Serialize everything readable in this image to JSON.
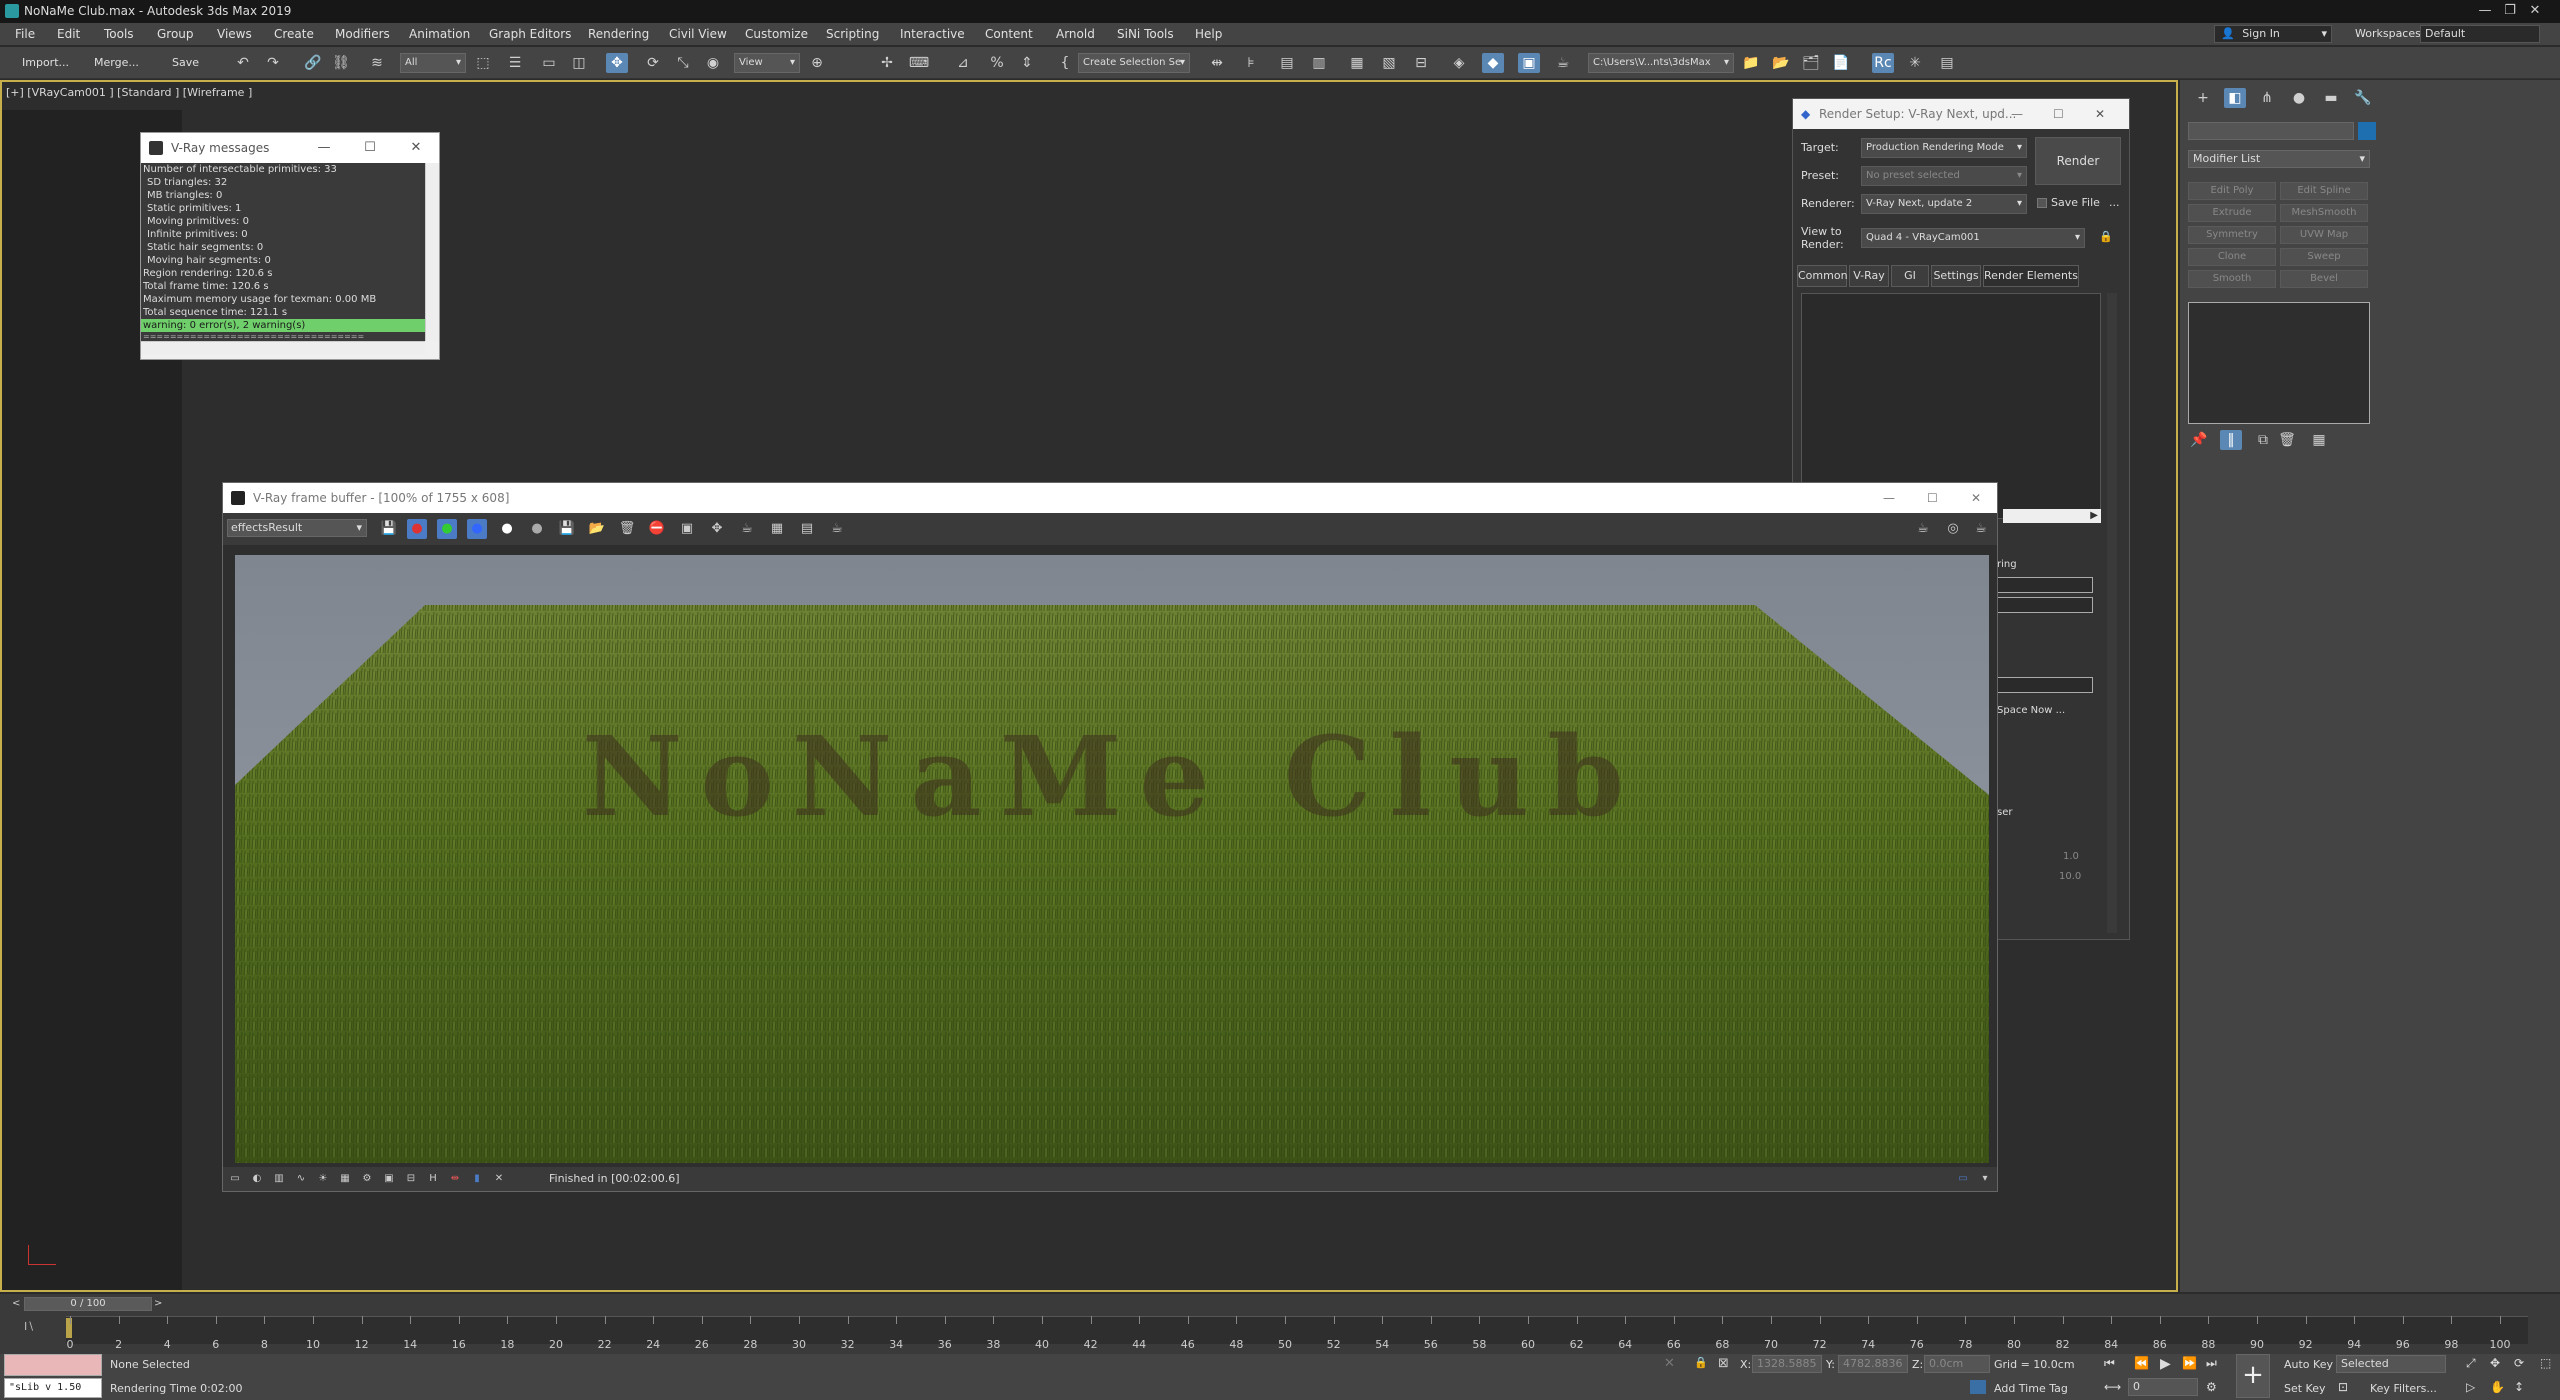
{
  "app": {
    "title": "NoNaMe Club.max - Autodesk 3ds Max 2019",
    "window_controls": {
      "minimize": "—",
      "restore": "❐",
      "close": "✕"
    }
  },
  "menu": [
    "File",
    "Edit",
    "Tools",
    "Group",
    "Views",
    "Create",
    "Modifiers",
    "Animation",
    "Graph Editors",
    "Rendering",
    "Civil View",
    "Customize",
    "Scripting",
    "Interactive",
    "Content",
    "Arnold",
    "SiNi Tools",
    "Help"
  ],
  "account": {
    "sign_in": "Sign In",
    "workspaces_label": "Workspaces:",
    "workspace_value": "Default"
  },
  "toolbar": {
    "import": "Import...",
    "merge": "Merge...",
    "save": "Save",
    "filter_value": "All",
    "ref_coord_value": "View",
    "selection_set_placeholder": "Create Selection Se",
    "path_value": "C:\\Users\\V...nts\\3dsMax"
  },
  "viewport": {
    "label": "[+] [VRayCam001 ] [Standard ] [Wireframe ]"
  },
  "vray_messages": {
    "title": "V-Ray messages",
    "lines": [
      "Number of intersectable primitives: 33",
      "SD triangles: 32",
      "MB triangles: 0",
      "Static primitives: 1",
      "Moving primitives: 0",
      "Infinite primitives: 0",
      "Static hair segments: 0",
      "Moving hair segments: 0",
      "Region rendering: 120.6 s",
      "Total frame time: 120.6 s",
      "Maximum memory usage for texman: 0.00 MB",
      "Total sequence time: 121.1 s"
    ],
    "warning_line": "warning: 0 error(s), 2 warning(s)",
    "separator": "================================="
  },
  "render_setup": {
    "title": "Render Setup: V-Ray Next, upd...",
    "target_label": "Target:",
    "target_value": "Production Rendering Mode",
    "preset_label": "Preset:",
    "preset_value": "No preset selected",
    "renderer_label": "Renderer:",
    "renderer_value": "V-Ray Next, update 2",
    "save_file_label": "Save File",
    "view_label": "View to Render:",
    "view_value": "Quad 4 - VRayCam001",
    "render_button": "Render",
    "more_button": "...",
    "tabs": [
      "Common",
      "V-Ray",
      "GI",
      "Settings",
      "Render Elements"
    ],
    "active_tab": "Render Elements",
    "partial_ring": "ring",
    "partial_space": "Space Now ...",
    "partial_ser": "ser",
    "val_a": "1.0",
    "val_b": "10.0"
  },
  "frame_buffer": {
    "title": "V-Ray frame buffer - [100% of 1755 x 608]",
    "channel_value": "effectsResult",
    "status": "Finished in [00:02:00.6]",
    "render_grass": "#4f6a24",
    "sky_color": "#8a9098",
    "rendered_word": "NoNaMe Club"
  },
  "command_panel": {
    "modifier_list": "Modifier List",
    "buttons": [
      "Edit Poly",
      "Edit Spline",
      "Extrude",
      "MeshSmooth",
      "Symmetry",
      "UVW Map",
      "Clone",
      "Sweep",
      "Smooth",
      "Bevel"
    ]
  },
  "timeline": {
    "frame_counter": "0 / 100",
    "ticks": [
      0,
      2,
      4,
      6,
      8,
      10,
      12,
      14,
      16,
      18,
      20,
      22,
      24,
      26,
      28,
      30,
      32,
      34,
      36,
      38,
      40,
      42,
      44,
      46,
      48,
      50,
      52,
      54,
      56,
      58,
      60,
      62,
      64,
      66,
      68,
      70,
      72,
      74,
      76,
      78,
      80,
      82,
      84,
      86,
      88,
      90,
      92,
      94,
      96,
      98,
      100
    ]
  },
  "status": {
    "maxscript": "\"sLib v 1.50",
    "selection": "None Selected",
    "render_time": "Rendering Time  0:02:00",
    "x_label": "X:",
    "x_value": "1328.5885",
    "y_label": "Y:",
    "y_value": "4782.8836",
    "z_label": "Z:",
    "z_value": "0.0cm",
    "grid": "Grid = 10.0cm",
    "add_time_tag": "Add Time Tag",
    "auto_key": "Auto Key",
    "set_key": "Set Key",
    "selected_value": "Selected",
    "key_filters": "Key Filters...",
    "frame_value": "0"
  }
}
